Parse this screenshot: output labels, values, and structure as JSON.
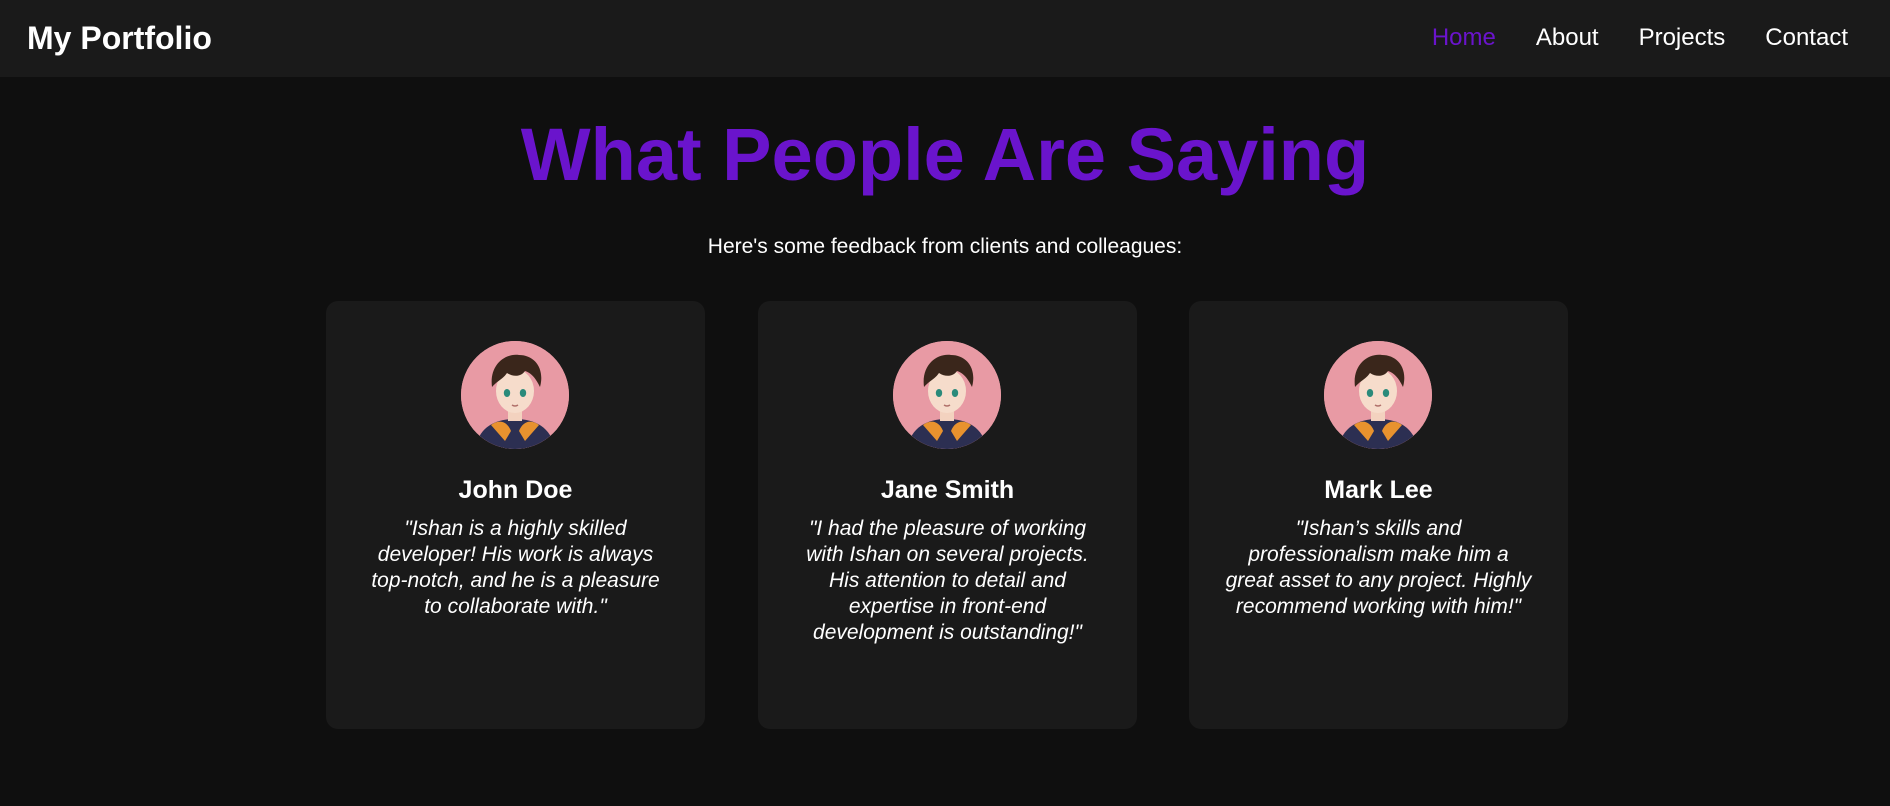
{
  "navbar": {
    "brand": "My Portfolio",
    "links": [
      {
        "label": "Home",
        "active": true
      },
      {
        "label": "About",
        "active": false
      },
      {
        "label": "Projects",
        "active": false
      },
      {
        "label": "Contact",
        "active": false
      }
    ]
  },
  "main": {
    "heading": "What People Are Saying",
    "subtitle": "Here's some feedback from clients and colleagues:",
    "testimonials": [
      {
        "name": "John Doe",
        "quote": "\"Ishan is a highly skilled developer! His work is always top-notch, and he is a pleasure to collaborate with.\"",
        "avatar_icon": "anime-boy-avatar"
      },
      {
        "name": "Jane Smith",
        "quote": "\"I had the pleasure of working with Ishan on several projects. His attention to detail and expertise in front-end development is outstanding!\"",
        "avatar_icon": "anime-boy-avatar"
      },
      {
        "name": "Mark Lee",
        "quote": "\"Ishan’s skills and professionalism make him a great asset to any project. Highly recommend working with him!\"",
        "avatar_icon": "anime-boy-avatar"
      }
    ]
  },
  "colors": {
    "accent": "#6a14cc",
    "background": "#0f0f0f",
    "surface": "#1a1a1a",
    "text": "#ffffff",
    "avatar_bg": "#e89aa4"
  }
}
